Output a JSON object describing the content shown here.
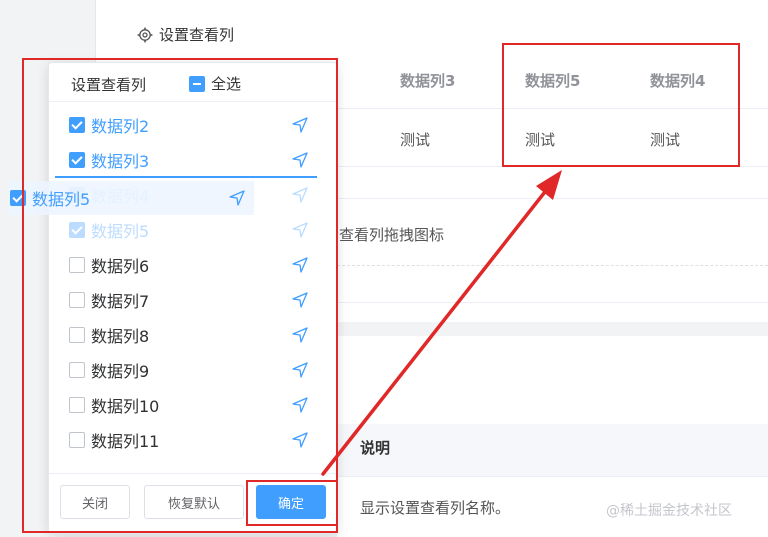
{
  "background": {
    "settings_link": "设置查看列",
    "columns": [
      {
        "header": "数据列3",
        "value": "测试"
      },
      {
        "header": "数据列5",
        "value": "测试"
      },
      {
        "header": "数据列4",
        "value": "测试"
      }
    ],
    "desc_text": "示查看列拖拽图标",
    "table2": {
      "header": "说明",
      "cell": "显示设置查看列名称。"
    },
    "watermark": "@稀土掘金技术社区"
  },
  "panel": {
    "title": "设置查看列",
    "select_all_label": "全选",
    "select_all_state": "indeterminate",
    "items": [
      {
        "label": "数据列2",
        "checked": true
      },
      {
        "label": "数据列3",
        "checked": true
      },
      {
        "label": "数据列4",
        "checked": true
      },
      {
        "label": "数据列5",
        "checked": true
      },
      {
        "label": "数据列6",
        "checked": false
      },
      {
        "label": "数据列7",
        "checked": false
      },
      {
        "label": "数据列8",
        "checked": false
      },
      {
        "label": "数据列9",
        "checked": false
      },
      {
        "label": "数据列10",
        "checked": false
      },
      {
        "label": "数据列11",
        "checked": false
      }
    ],
    "dragging_item": {
      "label": "数据列5",
      "checked": true
    },
    "buttons": {
      "close": "关闭",
      "reset": "恢复默认",
      "confirm": "确定"
    }
  },
  "icons": {
    "settings": "gear-icon",
    "pin": "pin-icon"
  },
  "colors": {
    "accent": "#409eff",
    "annotation": "#e02828"
  }
}
